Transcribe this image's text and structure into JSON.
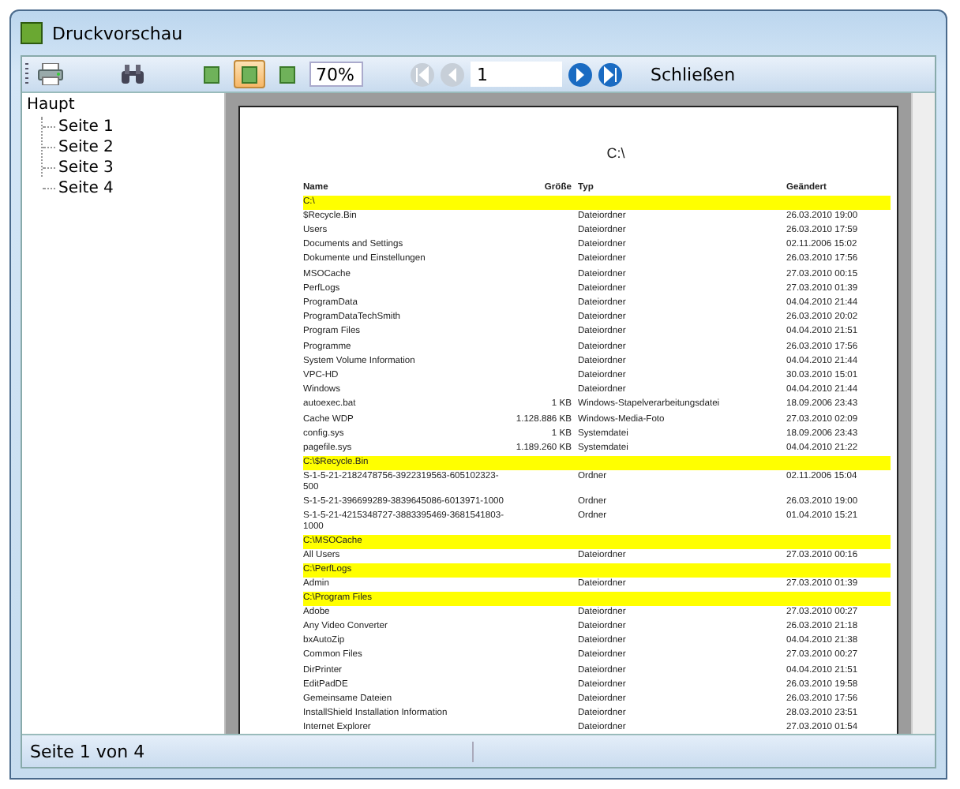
{
  "window": {
    "title": "Druckvorschau"
  },
  "toolbar": {
    "view_modes": [
      {
        "selected": false
      },
      {
        "selected": true
      },
      {
        "selected": false
      }
    ],
    "zoom": "70%",
    "nav": [
      {
        "kind": "first",
        "disabled": true
      },
      {
        "kind": "prev",
        "disabled": true
      },
      {
        "kind": "next",
        "disabled": false
      },
      {
        "kind": "last",
        "disabled": false
      }
    ],
    "page": "1",
    "close_label": "Schließen"
  },
  "tree": {
    "label": "Haupt",
    "children": [
      {
        "label": "Seite 1"
      },
      {
        "label": "Seite 2"
      },
      {
        "label": "Seite 3"
      },
      {
        "label": "Seite 4"
      }
    ]
  },
  "page": {
    "title": "C:\\",
    "columns": [
      "Name",
      "Größe",
      "Typ",
      "Geändert"
    ],
    "rows": [
      {
        "kind": "folder",
        "name": "C:\\"
      },
      {
        "kind": "entry",
        "name": "$Recycle.Bin",
        "size": "",
        "type": "Dateiordner",
        "date": "26.03.2010 19:00"
      },
      {
        "kind": "entry",
        "name": "Users",
        "size": "",
        "type": "Dateiordner",
        "date": "26.03.2010 17:59"
      },
      {
        "kind": "entry",
        "name": "Documents and Settings",
        "size": "",
        "type": "Dateiordner",
        "date": "02.11.2006 15:02"
      },
      {
        "kind": "entry",
        "name": "Dokumente und Einstellungen",
        "size": "",
        "type": "Dateiordner",
        "date": "26.03.2010 17:56"
      },
      {
        "kind": "entry",
        "name": "MSOCache",
        "size": "",
        "type": "Dateiordner",
        "date": "27.03.2010 00:15"
      },
      {
        "kind": "entry",
        "name": "PerfLogs",
        "size": "",
        "type": "Dateiordner",
        "date": "27.03.2010 01:39"
      },
      {
        "kind": "entry",
        "name": "ProgramData",
        "size": "",
        "type": "Dateiordner",
        "date": "04.04.2010 21:44"
      },
      {
        "kind": "entry",
        "name": "ProgramDataTechSmith",
        "size": "",
        "type": "Dateiordner",
        "date": "26.03.2010 20:02"
      },
      {
        "kind": "entry",
        "name": "Program Files",
        "size": "",
        "type": "Dateiordner",
        "date": "04.04.2010 21:51"
      },
      {
        "kind": "entry",
        "name": "Programme",
        "size": "",
        "type": "Dateiordner",
        "date": "26.03.2010 17:56"
      },
      {
        "kind": "entry",
        "name": "System Volume Information",
        "size": "",
        "type": "Dateiordner",
        "date": "04.04.2010 21:44"
      },
      {
        "kind": "entry",
        "name": "VPC-HD",
        "size": "",
        "type": "Dateiordner",
        "date": "30.03.2010 15:01"
      },
      {
        "kind": "entry",
        "name": "Windows",
        "size": "",
        "type": "Dateiordner",
        "date": "04.04.2010 21:44"
      },
      {
        "kind": "entry",
        "name": "autoexec.bat",
        "size": "1 KB",
        "type": "Windows-Stapelverarbeitungsdatei",
        "date": "18.09.2006 23:43"
      },
      {
        "kind": "entry",
        "name": "Cache WDP",
        "size": "1.128.886 KB",
        "type": "Windows-Media-Foto",
        "date": "27.03.2010 02:09"
      },
      {
        "kind": "entry",
        "name": "config.sys",
        "size": "1 KB",
        "type": "Systemdatei",
        "date": "18.09.2006 23:43"
      },
      {
        "kind": "entry",
        "name": "pagefile.sys",
        "size": "1.189.260 KB",
        "type": "Systemdatei",
        "date": "04.04.2010 21:22"
      },
      {
        "kind": "folder",
        "name": "C:\\$Recycle.Bin"
      },
      {
        "kind": "entry",
        "name": "S-1-5-21-2182478756-3922319563-605102323-500",
        "size": "",
        "type": "Ordner",
        "date": "02.11.2006 15:04"
      },
      {
        "kind": "entry",
        "name": "S-1-5-21-396699289-3839645086-6013971-1000",
        "size": "",
        "type": "Ordner",
        "date": "26.03.2010 19:00"
      },
      {
        "kind": "entry",
        "name": "S-1-5-21-4215348727-3883395469-3681541803-1000",
        "size": "",
        "type": "Ordner",
        "date": "01.04.2010 15:21"
      },
      {
        "kind": "folder",
        "name": "C:\\MSOCache"
      },
      {
        "kind": "entry",
        "name": "All Users",
        "size": "",
        "type": "Dateiordner",
        "date": "27.03.2010 00:16"
      },
      {
        "kind": "folder",
        "name": "C:\\PerfLogs"
      },
      {
        "kind": "entry",
        "name": "Admin",
        "size": "",
        "type": "Dateiordner",
        "date": "27.03.2010 01:39"
      },
      {
        "kind": "folder",
        "name": "C:\\Program Files"
      },
      {
        "kind": "entry",
        "name": "Adobe",
        "size": "",
        "type": "Dateiordner",
        "date": "27.03.2010 00:27"
      },
      {
        "kind": "entry",
        "name": "Any Video Converter",
        "size": "",
        "type": "Dateiordner",
        "date": "26.03.2010 21:18"
      },
      {
        "kind": "entry",
        "name": "bxAutoZip",
        "size": "",
        "type": "Dateiordner",
        "date": "04.04.2010 21:38"
      },
      {
        "kind": "entry",
        "name": "Common Files",
        "size": "",
        "type": "Dateiordner",
        "date": "27.03.2010 00:27"
      },
      {
        "kind": "entry",
        "name": "DirPrinter",
        "size": "",
        "type": "Dateiordner",
        "date": "04.04.2010 21:51"
      },
      {
        "kind": "entry",
        "name": "EditPadDE",
        "size": "",
        "type": "Dateiordner",
        "date": "26.03.2010 19:58"
      },
      {
        "kind": "entry",
        "name": "Gemeinsame Dateien",
        "size": "",
        "type": "Dateiordner",
        "date": "26.03.2010 17:56"
      },
      {
        "kind": "entry",
        "name": "InstallShield Installation Information",
        "size": "",
        "type": "Dateiordner",
        "date": "28.03.2010 23:51"
      },
      {
        "kind": "entry",
        "name": "Internet Explorer",
        "size": "",
        "type": "Dateiordner",
        "date": "27.03.2010 01:54"
      }
    ]
  },
  "status_bar": {
    "text": "Seite 1 von 4"
  }
}
